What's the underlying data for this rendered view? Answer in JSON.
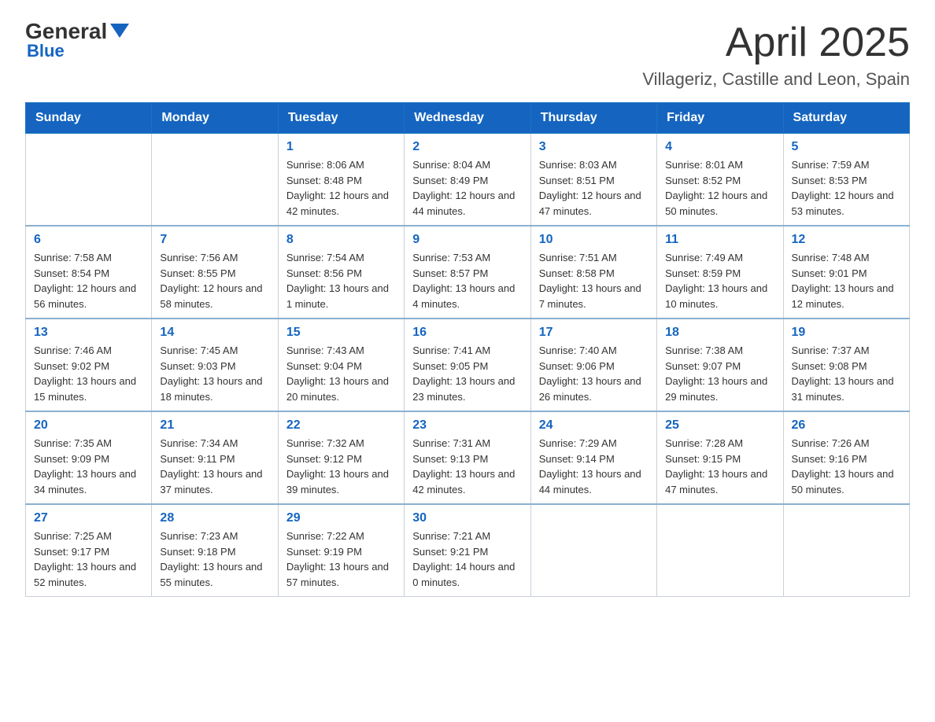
{
  "header": {
    "logo_general": "General",
    "logo_blue": "Blue",
    "month_title": "April 2025",
    "location": "Villageriz, Castille and Leon, Spain"
  },
  "weekdays": [
    "Sunday",
    "Monday",
    "Tuesday",
    "Wednesday",
    "Thursday",
    "Friday",
    "Saturday"
  ],
  "weeks": [
    [
      {
        "day": "",
        "sunrise": "",
        "sunset": "",
        "daylight": ""
      },
      {
        "day": "",
        "sunrise": "",
        "sunset": "",
        "daylight": ""
      },
      {
        "day": "1",
        "sunrise": "Sunrise: 8:06 AM",
        "sunset": "Sunset: 8:48 PM",
        "daylight": "Daylight: 12 hours and 42 minutes."
      },
      {
        "day": "2",
        "sunrise": "Sunrise: 8:04 AM",
        "sunset": "Sunset: 8:49 PM",
        "daylight": "Daylight: 12 hours and 44 minutes."
      },
      {
        "day": "3",
        "sunrise": "Sunrise: 8:03 AM",
        "sunset": "Sunset: 8:51 PM",
        "daylight": "Daylight: 12 hours and 47 minutes."
      },
      {
        "day": "4",
        "sunrise": "Sunrise: 8:01 AM",
        "sunset": "Sunset: 8:52 PM",
        "daylight": "Daylight: 12 hours and 50 minutes."
      },
      {
        "day": "5",
        "sunrise": "Sunrise: 7:59 AM",
        "sunset": "Sunset: 8:53 PM",
        "daylight": "Daylight: 12 hours and 53 minutes."
      }
    ],
    [
      {
        "day": "6",
        "sunrise": "Sunrise: 7:58 AM",
        "sunset": "Sunset: 8:54 PM",
        "daylight": "Daylight: 12 hours and 56 minutes."
      },
      {
        "day": "7",
        "sunrise": "Sunrise: 7:56 AM",
        "sunset": "Sunset: 8:55 PM",
        "daylight": "Daylight: 12 hours and 58 minutes."
      },
      {
        "day": "8",
        "sunrise": "Sunrise: 7:54 AM",
        "sunset": "Sunset: 8:56 PM",
        "daylight": "Daylight: 13 hours and 1 minute."
      },
      {
        "day": "9",
        "sunrise": "Sunrise: 7:53 AM",
        "sunset": "Sunset: 8:57 PM",
        "daylight": "Daylight: 13 hours and 4 minutes."
      },
      {
        "day": "10",
        "sunrise": "Sunrise: 7:51 AM",
        "sunset": "Sunset: 8:58 PM",
        "daylight": "Daylight: 13 hours and 7 minutes."
      },
      {
        "day": "11",
        "sunrise": "Sunrise: 7:49 AM",
        "sunset": "Sunset: 8:59 PM",
        "daylight": "Daylight: 13 hours and 10 minutes."
      },
      {
        "day": "12",
        "sunrise": "Sunrise: 7:48 AM",
        "sunset": "Sunset: 9:01 PM",
        "daylight": "Daylight: 13 hours and 12 minutes."
      }
    ],
    [
      {
        "day": "13",
        "sunrise": "Sunrise: 7:46 AM",
        "sunset": "Sunset: 9:02 PM",
        "daylight": "Daylight: 13 hours and 15 minutes."
      },
      {
        "day": "14",
        "sunrise": "Sunrise: 7:45 AM",
        "sunset": "Sunset: 9:03 PM",
        "daylight": "Daylight: 13 hours and 18 minutes."
      },
      {
        "day": "15",
        "sunrise": "Sunrise: 7:43 AM",
        "sunset": "Sunset: 9:04 PM",
        "daylight": "Daylight: 13 hours and 20 minutes."
      },
      {
        "day": "16",
        "sunrise": "Sunrise: 7:41 AM",
        "sunset": "Sunset: 9:05 PM",
        "daylight": "Daylight: 13 hours and 23 minutes."
      },
      {
        "day": "17",
        "sunrise": "Sunrise: 7:40 AM",
        "sunset": "Sunset: 9:06 PM",
        "daylight": "Daylight: 13 hours and 26 minutes."
      },
      {
        "day": "18",
        "sunrise": "Sunrise: 7:38 AM",
        "sunset": "Sunset: 9:07 PM",
        "daylight": "Daylight: 13 hours and 29 minutes."
      },
      {
        "day": "19",
        "sunrise": "Sunrise: 7:37 AM",
        "sunset": "Sunset: 9:08 PM",
        "daylight": "Daylight: 13 hours and 31 minutes."
      }
    ],
    [
      {
        "day": "20",
        "sunrise": "Sunrise: 7:35 AM",
        "sunset": "Sunset: 9:09 PM",
        "daylight": "Daylight: 13 hours and 34 minutes."
      },
      {
        "day": "21",
        "sunrise": "Sunrise: 7:34 AM",
        "sunset": "Sunset: 9:11 PM",
        "daylight": "Daylight: 13 hours and 37 minutes."
      },
      {
        "day": "22",
        "sunrise": "Sunrise: 7:32 AM",
        "sunset": "Sunset: 9:12 PM",
        "daylight": "Daylight: 13 hours and 39 minutes."
      },
      {
        "day": "23",
        "sunrise": "Sunrise: 7:31 AM",
        "sunset": "Sunset: 9:13 PM",
        "daylight": "Daylight: 13 hours and 42 minutes."
      },
      {
        "day": "24",
        "sunrise": "Sunrise: 7:29 AM",
        "sunset": "Sunset: 9:14 PM",
        "daylight": "Daylight: 13 hours and 44 minutes."
      },
      {
        "day": "25",
        "sunrise": "Sunrise: 7:28 AM",
        "sunset": "Sunset: 9:15 PM",
        "daylight": "Daylight: 13 hours and 47 minutes."
      },
      {
        "day": "26",
        "sunrise": "Sunrise: 7:26 AM",
        "sunset": "Sunset: 9:16 PM",
        "daylight": "Daylight: 13 hours and 50 minutes."
      }
    ],
    [
      {
        "day": "27",
        "sunrise": "Sunrise: 7:25 AM",
        "sunset": "Sunset: 9:17 PM",
        "daylight": "Daylight: 13 hours and 52 minutes."
      },
      {
        "day": "28",
        "sunrise": "Sunrise: 7:23 AM",
        "sunset": "Sunset: 9:18 PM",
        "daylight": "Daylight: 13 hours and 55 minutes."
      },
      {
        "day": "29",
        "sunrise": "Sunrise: 7:22 AM",
        "sunset": "Sunset: 9:19 PM",
        "daylight": "Daylight: 13 hours and 57 minutes."
      },
      {
        "day": "30",
        "sunrise": "Sunrise: 7:21 AM",
        "sunset": "Sunset: 9:21 PM",
        "daylight": "Daylight: 14 hours and 0 minutes."
      },
      {
        "day": "",
        "sunrise": "",
        "sunset": "",
        "daylight": ""
      },
      {
        "day": "",
        "sunrise": "",
        "sunset": "",
        "daylight": ""
      },
      {
        "day": "",
        "sunrise": "",
        "sunset": "",
        "daylight": ""
      }
    ]
  ]
}
